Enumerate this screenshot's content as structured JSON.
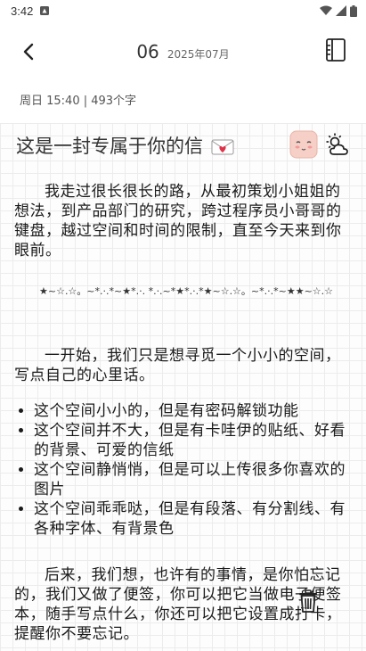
{
  "status_bar": {
    "time": "3:42"
  },
  "header": {
    "day": "06",
    "year_month": "2025年07月"
  },
  "meta": {
    "text": "周日 15:40 | 493个字"
  },
  "note": {
    "title": "这是一封专属于你的信",
    "para1": "我走过很长很长的路，从最初策划小姐姐的想法，到产品部门的研究，跨过程序员小哥哥的键盘，越过空间和时间的限制，直至今天来到你眼前。",
    "divider": "★~☆.☆。~*.·.*~★*.·. *.·.~*★*.·.*★~☆.☆。~*.·.*~★★~☆.☆",
    "para2": "一开始，我们只是想寻觅一个小小的空间，写点自己的心里话。",
    "bullets": [
      "这个空间小小的，但是有密码解锁功能",
      "这个空间并不大，但是有卡哇伊的贴纸、好看的背景、可爱的信纸",
      "这个空间静悄悄，但是可以上传很多你喜欢的图片",
      "这个空间乖乖哒，但是有段落、有分割线、有各种字体、有背景色"
    ],
    "para3": "后来，我们想，也许有的事情，是你怕忘记的，我们又做了便签，你可以把它当做电子便签本，随手写点什么，你还可以把它设置成打卡，提醒你不要忘记。"
  },
  "icons": {
    "back": "back-arrow-icon",
    "book": "book-icon",
    "sticker": "blush-face-sticker-icon",
    "weather": "partly-cloudy-icon",
    "delete": "trash-icon",
    "envelope": "love-letter-icon"
  }
}
